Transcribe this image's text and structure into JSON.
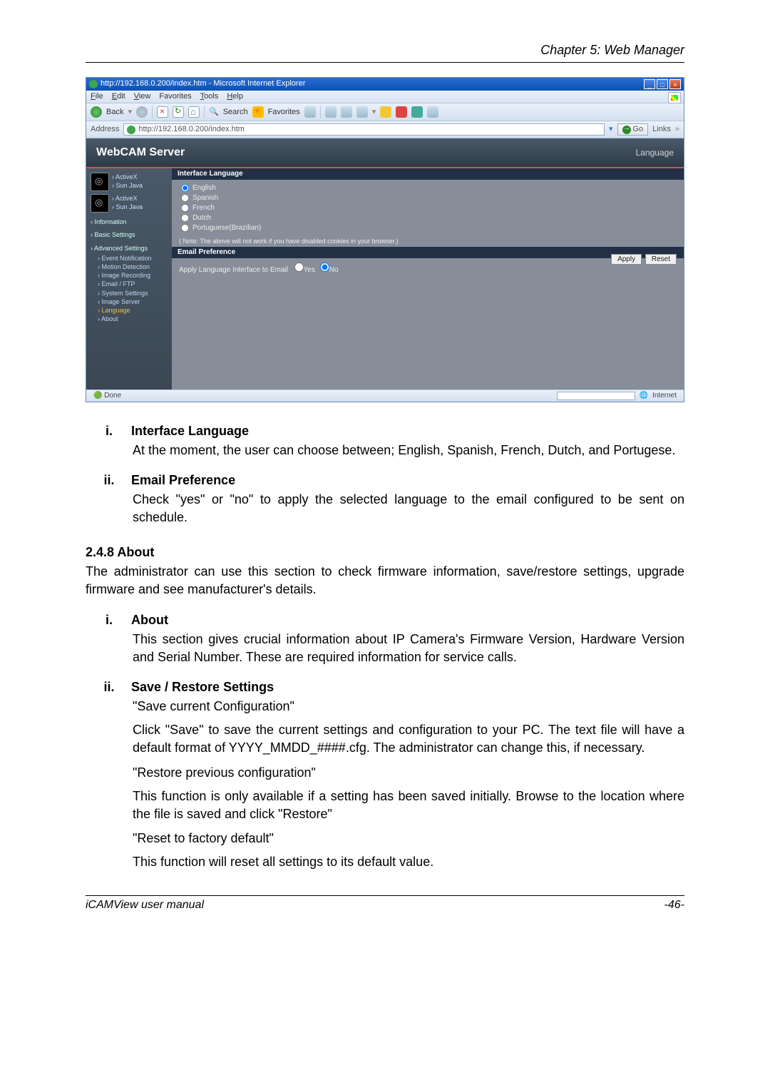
{
  "chapter": "Chapter 5: Web Manager",
  "titlebar": "http://192.168.0.200/index.htm - Microsoft Internet Explorer",
  "menu": {
    "file": "File",
    "edit": "Edit",
    "view": "View",
    "favorites": "Favorites",
    "tools": "Tools",
    "help": "Help"
  },
  "toolbar": {
    "back": "Back",
    "search": "Search",
    "favorites": "Favorites"
  },
  "address": {
    "label": "Address",
    "url": "http://192.168.0.200/index.htm",
    "go": "Go",
    "links": "Links"
  },
  "webcam": {
    "title": "WebCAM Server",
    "banner_right": "Language",
    "camA": {
      "activex": "ActiveX",
      "sunjava": "Sun Java"
    },
    "camB": {
      "activex": "ActiveX",
      "sunjava": "Sun Java"
    },
    "sidebar": {
      "info": "Information",
      "basic": "Basic Settings",
      "adv": "Advanced Settings",
      "items": {
        "event": "Event Notification",
        "motion": "Motion Detection",
        "imgrec": "Image Recording",
        "email": "Email / FTP",
        "system": "System Settings",
        "imgserv": "Image Server",
        "language": "Language",
        "about": "About"
      }
    },
    "panel": {
      "sec1": "Interface Language",
      "opts": {
        "english": "English",
        "spanish": "Spanish",
        "french": "French",
        "dutch": "Dutch",
        "portuguese": "Portuguese(Brazilian)"
      },
      "note": "( Note: The above will not work if you have disabled cookies in your browser.)",
      "sec2": "Email Preference",
      "question": "Apply Language Interface to Email",
      "yes": "Yes",
      "no": "No",
      "apply": "Apply",
      "reset": "Reset"
    }
  },
  "statusbar": {
    "done": "Done",
    "internet": "Internet"
  },
  "doc": {
    "i1": {
      "rn": "i.",
      "title": "Interface Language",
      "body": "At the moment, the user can choose between; English, Spanish, French, Dutch, and Portugese."
    },
    "i2": {
      "rn": "ii.",
      "title": "Email Preference",
      "body": "Check \"yes\" or \"no\" to apply the selected language to the email configured to be sent on schedule."
    },
    "h248": "2.4.8 About",
    "p248": "The administrator can use this section to check firmware information, save/restore settings, upgrade firmware and see manufacturer's details.",
    "a1": {
      "rn": "i.",
      "title": "About",
      "body": "This section gives crucial information about IP Camera's Firmware Version, Hardware Version and Serial Number.  These are required information for service calls."
    },
    "a2": {
      "rn": "ii.",
      "title": "Save / Restore Settings",
      "q1": "\"Save current Configuration\"",
      "b1": "Click \"Save\" to save the current settings and configuration to your PC.   The text file will have a default format of YYYY_MMDD_####.cfg.  The administrator can change this, if necessary.",
      "q2": "\"Restore previous configuration\"",
      "b2": "This function is only available if a setting has been saved initially.   Browse to the location where the file is saved and click \"Restore\"",
      "q3": "\"Reset to factory default\"",
      "b3": "This function will reset all settings to its default value."
    }
  },
  "footer": {
    "left": "iCAMView  user  manual",
    "right": "-46-"
  }
}
